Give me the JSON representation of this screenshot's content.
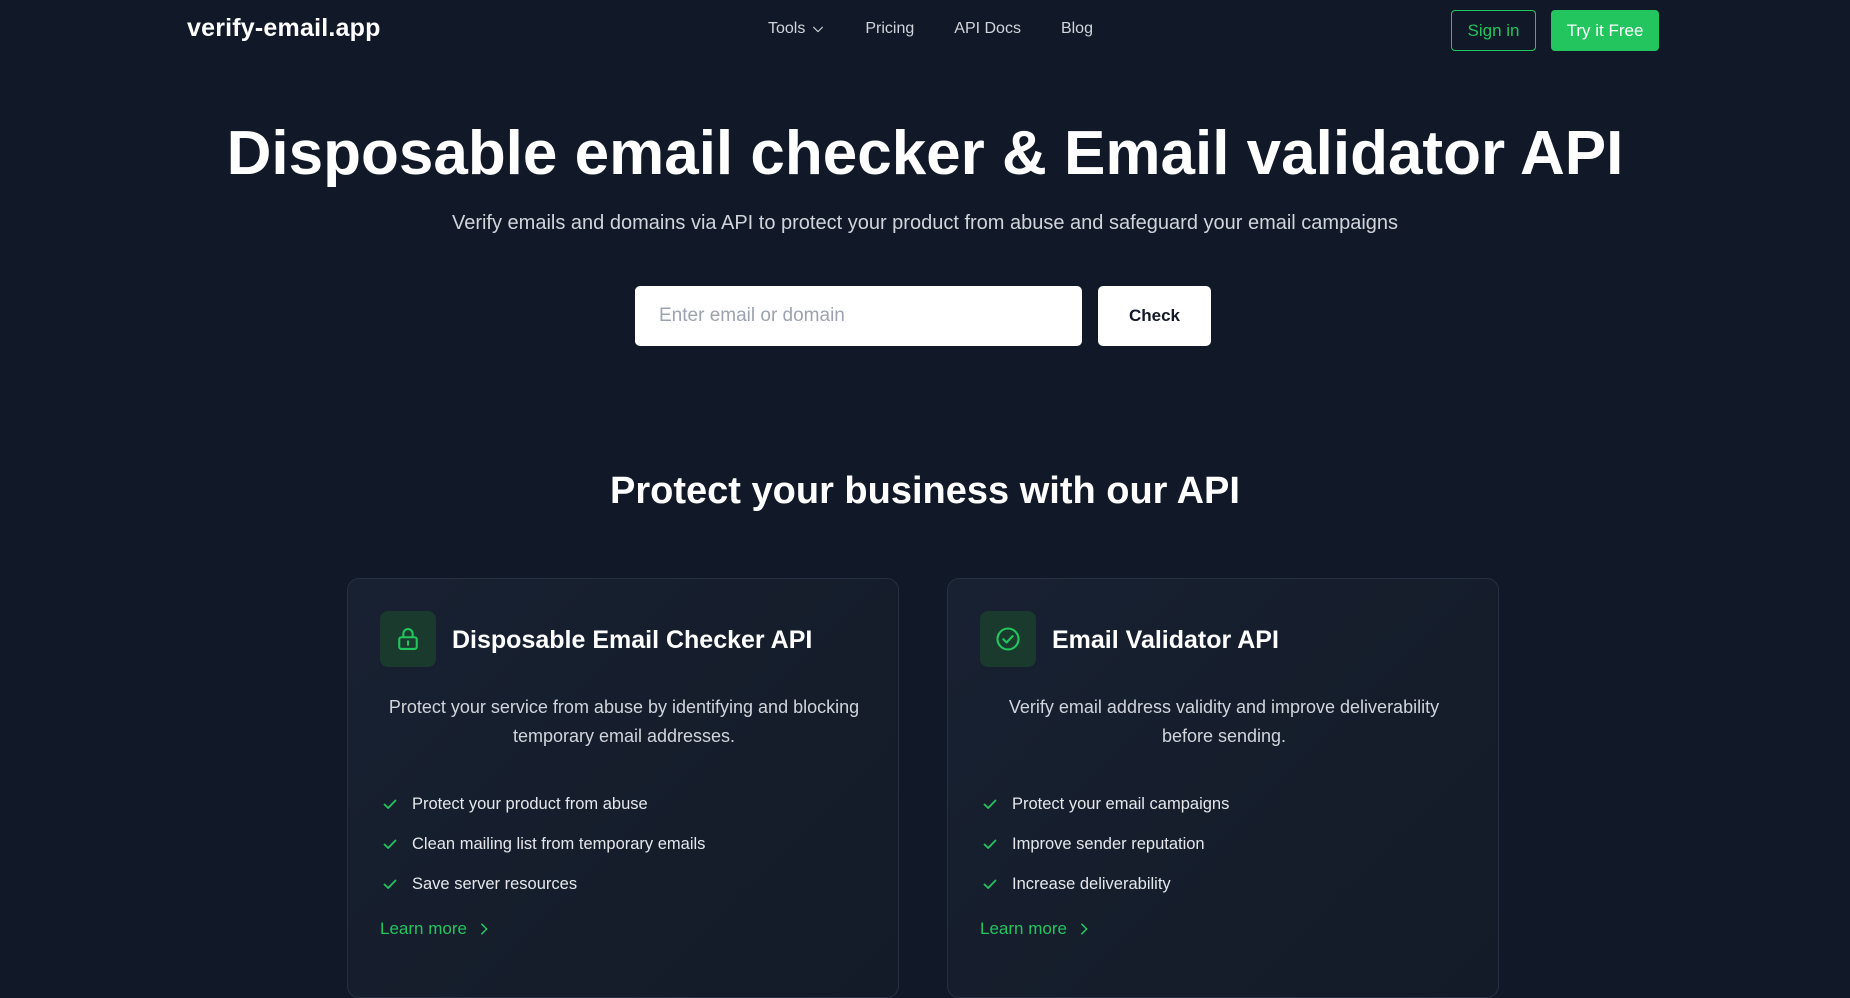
{
  "header": {
    "logo": "verify-email.app",
    "nav": [
      {
        "label": "Tools",
        "icon": "chevron-down-icon"
      },
      {
        "label": "Pricing"
      },
      {
        "label": "API Docs"
      },
      {
        "label": "Blog"
      }
    ],
    "signin_label": "Sign in",
    "try_label": "Try it Free"
  },
  "hero": {
    "title": "Disposable email checker & Email validator API",
    "subtitle": "Verify emails and domains via API to protect your product from abuse and safeguard your email campaigns",
    "search_placeholder": "Enter email or domain",
    "search_value": "",
    "check_label": "Check"
  },
  "section": {
    "title": "Protect your business with our API"
  },
  "cards": [
    {
      "icon": "lock-icon",
      "title": "Disposable Email Checker API",
      "description": "Protect your service from abuse by identifying and blocking temporary email addresses.",
      "features": [
        "Protect your product from abuse",
        "Clean mailing list from temporary emails",
        "Save server resources"
      ],
      "learn_more": "Learn more"
    },
    {
      "icon": "check-circle-icon",
      "title": "Email Validator API",
      "description": "Verify email address validity and improve deliverability before sending.",
      "features": [
        "Protect your email campaigns",
        "Improve sender reputation",
        "Increase deliverability"
      ],
      "learn_more": "Learn more"
    }
  ],
  "colors": {
    "background": "#111827",
    "accent": "#22c55e",
    "card_border": "#263041",
    "icon_box": "#1a3a2e"
  }
}
